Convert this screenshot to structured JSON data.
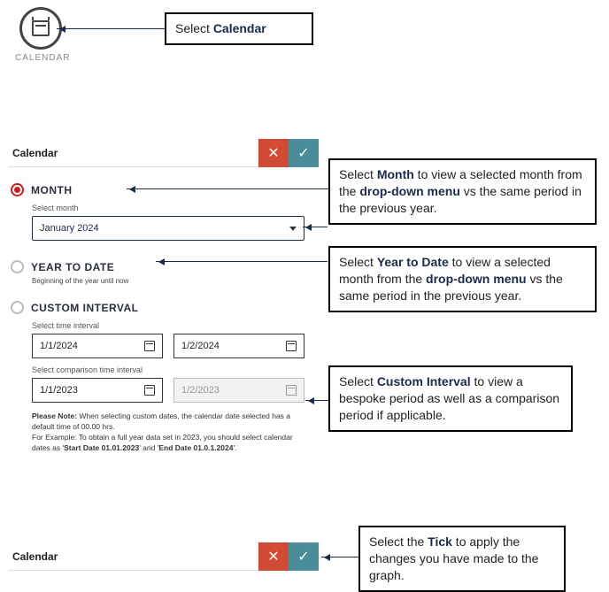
{
  "calendar_icon_label": "CALENDAR",
  "callouts": {
    "top": {
      "pre": "Select ",
      "bold": "Calendar",
      "post": ""
    },
    "month": {
      "t1": "Select ",
      "b1": "Month",
      "t2": " to view a selected month from the ",
      "b2": "drop-down menu",
      "t3": " vs the same period in the previous year."
    },
    "ytd": {
      "t1": "Select ",
      "b1": "Year to Date",
      "t2": " to view a selected month from the ",
      "b2": "drop-down menu",
      "t3": " vs the same period in the previous year."
    },
    "custom": {
      "t1": "Select ",
      "b1": "Custom Interval",
      "t2": " to view a bespoke period as well as a comparison period if applicable."
    },
    "tick": {
      "t1": "Select the ",
      "b1": "Tick",
      "t2": " to apply the changes you have made to the graph."
    }
  },
  "panel_title": "Calendar",
  "close_glyph": "✕",
  "tick_glyph": "✓",
  "options": {
    "month": "MONTH",
    "ytd": "YEAR TO DATE",
    "custom": "CUSTOM INTERVAL"
  },
  "month": {
    "sub": "Select month",
    "value": "January 2024"
  },
  "ytd_note": "Beginning of the year until now",
  "custom": {
    "sub1": "Select time interval",
    "start": "1/1/2024",
    "end": "1/2/2024",
    "sub2": "Select comparison time interval",
    "cstart": "1/1/2023",
    "cend": "1/2/2023"
  },
  "note": {
    "l1a": "Please Note:",
    "l1b": " When selecting custom dates, the calendar date selected has a default time of 00.00 hrs.",
    "l2a": "For Example: To obtain a full year data set in 2023, you should select calendar dates as '",
    "l2b": "Start Date 01.01.2023",
    "l2c": "' and '",
    "l2d": "End Date 01.0.1.2024",
    "l2e": "'."
  }
}
